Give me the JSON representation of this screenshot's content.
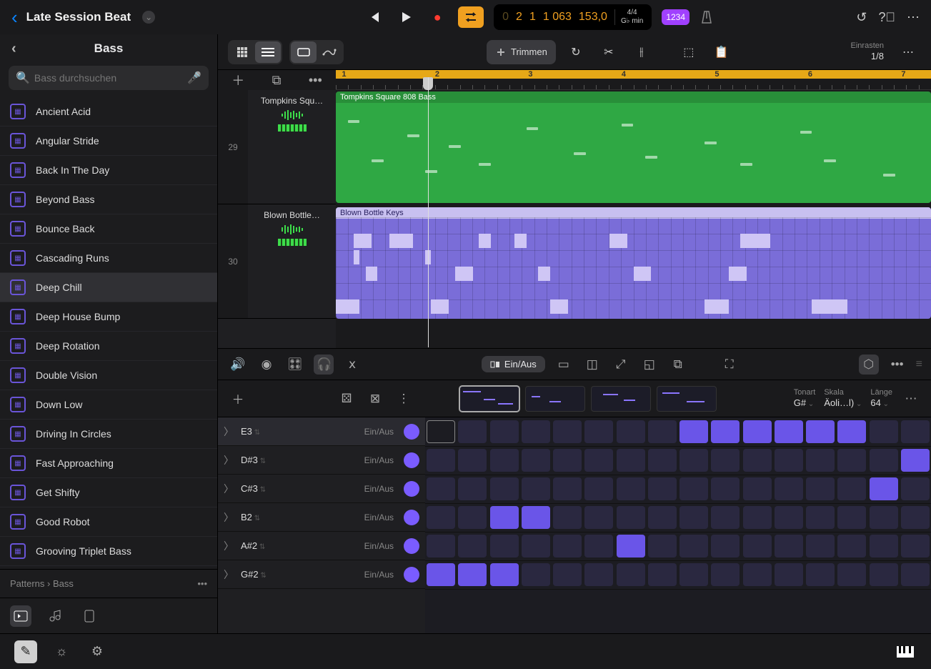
{
  "header": {
    "project_title": "Late Session Beat",
    "lcd_bar": "2",
    "lcd_beat": "1",
    "lcd_ticks": "1 063",
    "lcd_tempo": "153,0",
    "sig_top": "4/4",
    "sig_key": "G♭ min",
    "countin": "1234"
  },
  "sidebar": {
    "title": "Bass",
    "search_placeholder": "Bass durchsuchen",
    "items": [
      "Ancient Acid",
      "Angular Stride",
      "Back In The Day",
      "Beyond Bass",
      "Bounce Back",
      "Cascading Runs",
      "Deep Chill",
      "Deep House Bump",
      "Deep Rotation",
      "Double Vision",
      "Down Low",
      "Driving In Circles",
      "Fast Approaching",
      "Get Shifty",
      "Good Robot",
      "Grooving Triplet Bass"
    ],
    "selected": 6,
    "breadcrumb": "Patterns › Bass"
  },
  "toolbar": {
    "trim_label": "Trimmen",
    "snap_label": "Einrasten",
    "snap_value": "1/8"
  },
  "tracks": {
    "ruler_numbers": [
      "1",
      "2",
      "3",
      "4",
      "5",
      "6",
      "7"
    ],
    "t1_num": "29",
    "t1_name": "Tompkins Squ…",
    "t1_region": "Tompkins Square 808 Bass",
    "t2_num": "30",
    "t2_name": "Blown Bottle…",
    "t2_region": "Blown Bottle Keys"
  },
  "editor": {
    "einaus_label": "Ein/Aus",
    "key_label": "Tonart",
    "key_value": "G#",
    "scale_label": "Skala",
    "scale_value": "Äoli…l)",
    "len_label": "Länge",
    "len_value": "64",
    "rows": [
      {
        "name": "E3",
        "fill": [
          [
            8,
            14
          ]
        ]
      },
      {
        "name": "D#3",
        "fill": [
          [
            15,
            16
          ]
        ]
      },
      {
        "name": "C#3",
        "fill": [
          [
            14,
            15
          ]
        ]
      },
      {
        "name": "B2",
        "fill": [
          [
            2,
            4
          ]
        ]
      },
      {
        "name": "A#2",
        "fill": [
          [
            6,
            7
          ]
        ]
      },
      {
        "name": "G#2",
        "fill": [
          [
            0,
            3
          ]
        ]
      }
    ],
    "einaus_row": "Ein/Aus"
  }
}
